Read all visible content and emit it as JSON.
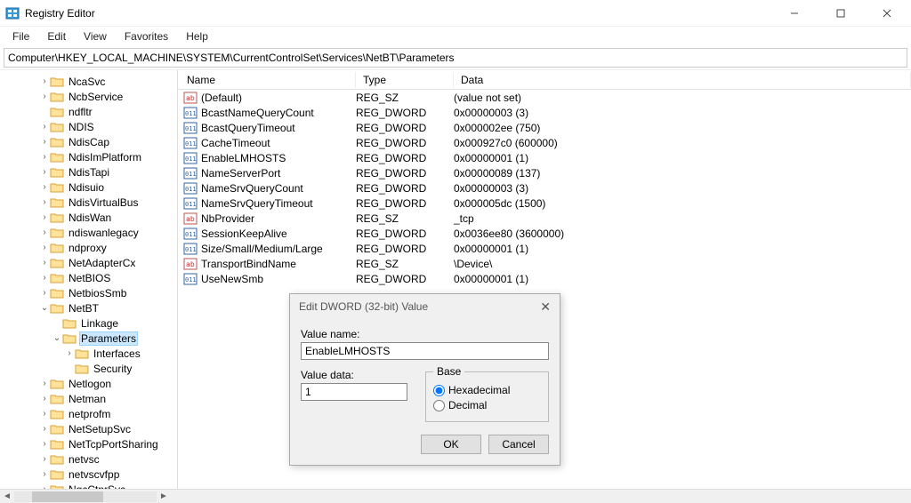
{
  "window": {
    "title": "Registry Editor"
  },
  "menubar": {
    "items": [
      "File",
      "Edit",
      "View",
      "Favorites",
      "Help"
    ]
  },
  "addressbar": {
    "path": "Computer\\HKEY_LOCAL_MACHINE\\SYSTEM\\CurrentControlSet\\Services\\NetBT\\Parameters"
  },
  "tree": [
    {
      "indent": 3,
      "exp": ">",
      "label": "NcaSvc"
    },
    {
      "indent": 3,
      "exp": ">",
      "label": "NcbService"
    },
    {
      "indent": 3,
      "exp": "",
      "label": "ndfltr"
    },
    {
      "indent": 3,
      "exp": ">",
      "label": "NDIS"
    },
    {
      "indent": 3,
      "exp": ">",
      "label": "NdisCap"
    },
    {
      "indent": 3,
      "exp": ">",
      "label": "NdisImPlatform"
    },
    {
      "indent": 3,
      "exp": ">",
      "label": "NdisTapi"
    },
    {
      "indent": 3,
      "exp": ">",
      "label": "Ndisuio"
    },
    {
      "indent": 3,
      "exp": ">",
      "label": "NdisVirtualBus"
    },
    {
      "indent": 3,
      "exp": ">",
      "label": "NdisWan"
    },
    {
      "indent": 3,
      "exp": ">",
      "label": "ndiswanlegacy"
    },
    {
      "indent": 3,
      "exp": ">",
      "label": "ndproxy"
    },
    {
      "indent": 3,
      "exp": ">",
      "label": "NetAdapterCx"
    },
    {
      "indent": 3,
      "exp": ">",
      "label": "NetBIOS"
    },
    {
      "indent": 3,
      "exp": ">",
      "label": "NetbiosSmb"
    },
    {
      "indent": 3,
      "exp": "v",
      "label": "NetBT"
    },
    {
      "indent": 4,
      "exp": "",
      "label": "Linkage"
    },
    {
      "indent": 4,
      "exp": "v",
      "label": "Parameters",
      "selected": true
    },
    {
      "indent": 5,
      "exp": ">",
      "label": "Interfaces"
    },
    {
      "indent": 5,
      "exp": "",
      "label": "Security"
    },
    {
      "indent": 3,
      "exp": ">",
      "label": "Netlogon"
    },
    {
      "indent": 3,
      "exp": ">",
      "label": "Netman"
    },
    {
      "indent": 3,
      "exp": ">",
      "label": "netprofm"
    },
    {
      "indent": 3,
      "exp": ">",
      "label": "NetSetupSvc"
    },
    {
      "indent": 3,
      "exp": ">",
      "label": "NetTcpPortSharing"
    },
    {
      "indent": 3,
      "exp": ">",
      "label": "netvsc"
    },
    {
      "indent": 3,
      "exp": ">",
      "label": "netvscvfpp"
    },
    {
      "indent": 3,
      "exp": ">",
      "label": "NgcCtnrSvc"
    }
  ],
  "list": {
    "columns": {
      "name": "Name",
      "type": "Type",
      "data": "Data"
    },
    "rows": [
      {
        "icon": "sz",
        "name": "(Default)",
        "type": "REG_SZ",
        "data": "(value not set)"
      },
      {
        "icon": "dw",
        "name": "BcastNameQueryCount",
        "type": "REG_DWORD",
        "data": "0x00000003 (3)"
      },
      {
        "icon": "dw",
        "name": "BcastQueryTimeout",
        "type": "REG_DWORD",
        "data": "0x000002ee (750)"
      },
      {
        "icon": "dw",
        "name": "CacheTimeout",
        "type": "REG_DWORD",
        "data": "0x000927c0 (600000)"
      },
      {
        "icon": "dw",
        "name": "EnableLMHOSTS",
        "type": "REG_DWORD",
        "data": "0x00000001 (1)"
      },
      {
        "icon": "dw",
        "name": "NameServerPort",
        "type": "REG_DWORD",
        "data": "0x00000089 (137)"
      },
      {
        "icon": "dw",
        "name": "NameSrvQueryCount",
        "type": "REG_DWORD",
        "data": "0x00000003 (3)"
      },
      {
        "icon": "dw",
        "name": "NameSrvQueryTimeout",
        "type": "REG_DWORD",
        "data": "0x000005dc (1500)"
      },
      {
        "icon": "sz",
        "name": "NbProvider",
        "type": "REG_SZ",
        "data": "_tcp"
      },
      {
        "icon": "dw",
        "name": "SessionKeepAlive",
        "type": "REG_DWORD",
        "data": "0x0036ee80 (3600000)"
      },
      {
        "icon": "dw",
        "name": "Size/Small/Medium/Large",
        "type": "REG_DWORD",
        "data": "0x00000001 (1)"
      },
      {
        "icon": "sz",
        "name": "TransportBindName",
        "type": "REG_SZ",
        "data": "\\Device\\"
      },
      {
        "icon": "dw",
        "name": "UseNewSmb",
        "type": "REG_DWORD",
        "data": "0x00000001 (1)"
      }
    ]
  },
  "dialog": {
    "title": "Edit DWORD (32-bit) Value",
    "value_name_label": "Value name:",
    "value_name": "EnableLMHOSTS",
    "value_data_label": "Value data:",
    "value_data": "1",
    "base_label": "Base",
    "hex_label": "Hexadecimal",
    "dec_label": "Decimal",
    "ok": "OK",
    "cancel": "Cancel"
  }
}
